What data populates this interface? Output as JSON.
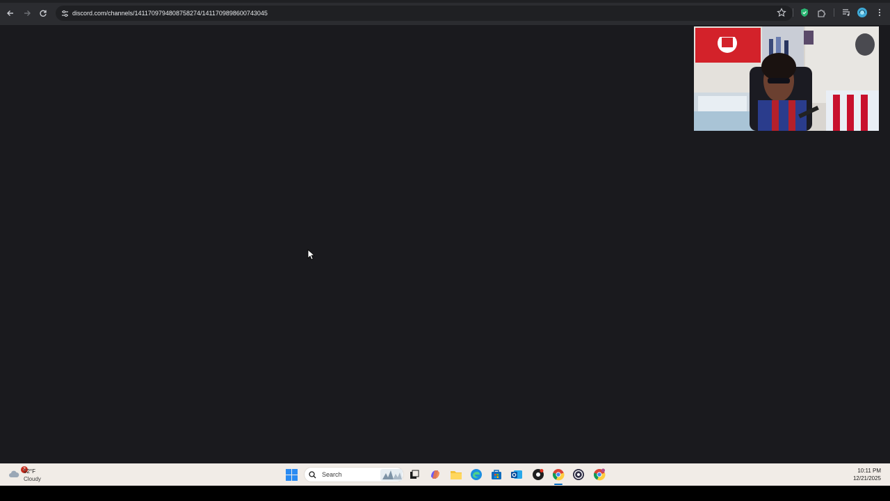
{
  "browser": {
    "url": "discord.com/channels/1411709794808758274/1411709898600743045",
    "nav": {
      "back_icon": "arrow-left-icon",
      "forward_icon": "arrow-right-icon",
      "reload_icon": "reload-icon"
    },
    "extensions": [
      "shield-extension-icon",
      "puzzle-extension-icon"
    ]
  },
  "page": {
    "background_color": "#1a1a1e",
    "video_overlay": "webcam-video"
  },
  "taskbar": {
    "weather": {
      "badge": "3",
      "temperature": "52°F",
      "condition": "Cloudy"
    },
    "search_label": "Search",
    "clock": {
      "time": "10:11 PM",
      "date": "12/21/2025"
    },
    "apps": [
      "start",
      "task-view",
      "copilot",
      "file-explorer",
      "edge",
      "microsoft-store",
      "mail",
      "app",
      "chrome",
      "obs",
      "chrome-profile"
    ]
  }
}
